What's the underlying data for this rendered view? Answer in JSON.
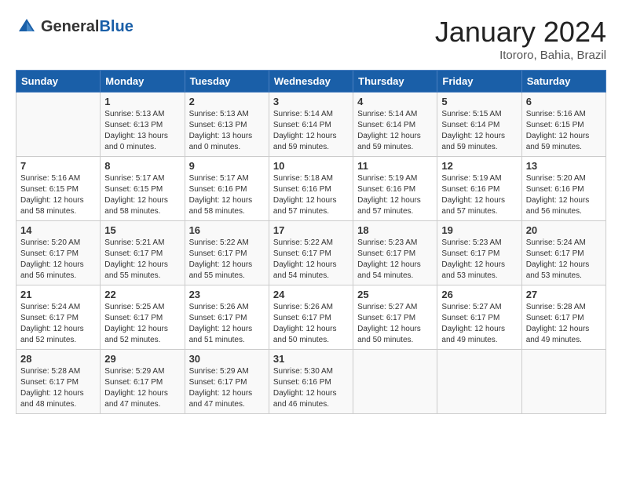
{
  "header": {
    "logo_general": "General",
    "logo_blue": "Blue",
    "title": "January 2024",
    "location": "Itororo, Bahia, Brazil"
  },
  "days_of_week": [
    "Sunday",
    "Monday",
    "Tuesday",
    "Wednesday",
    "Thursday",
    "Friday",
    "Saturday"
  ],
  "weeks": [
    [
      {
        "day": "",
        "detail": ""
      },
      {
        "day": "1",
        "detail": "Sunrise: 5:13 AM\nSunset: 6:13 PM\nDaylight: 13 hours\nand 0 minutes."
      },
      {
        "day": "2",
        "detail": "Sunrise: 5:13 AM\nSunset: 6:13 PM\nDaylight: 13 hours\nand 0 minutes."
      },
      {
        "day": "3",
        "detail": "Sunrise: 5:14 AM\nSunset: 6:14 PM\nDaylight: 12 hours\nand 59 minutes."
      },
      {
        "day": "4",
        "detail": "Sunrise: 5:14 AM\nSunset: 6:14 PM\nDaylight: 12 hours\nand 59 minutes."
      },
      {
        "day": "5",
        "detail": "Sunrise: 5:15 AM\nSunset: 6:14 PM\nDaylight: 12 hours\nand 59 minutes."
      },
      {
        "day": "6",
        "detail": "Sunrise: 5:16 AM\nSunset: 6:15 PM\nDaylight: 12 hours\nand 59 minutes."
      }
    ],
    [
      {
        "day": "7",
        "detail": "Sunrise: 5:16 AM\nSunset: 6:15 PM\nDaylight: 12 hours\nand 58 minutes."
      },
      {
        "day": "8",
        "detail": "Sunrise: 5:17 AM\nSunset: 6:15 PM\nDaylight: 12 hours\nand 58 minutes."
      },
      {
        "day": "9",
        "detail": "Sunrise: 5:17 AM\nSunset: 6:16 PM\nDaylight: 12 hours\nand 58 minutes."
      },
      {
        "day": "10",
        "detail": "Sunrise: 5:18 AM\nSunset: 6:16 PM\nDaylight: 12 hours\nand 57 minutes."
      },
      {
        "day": "11",
        "detail": "Sunrise: 5:19 AM\nSunset: 6:16 PM\nDaylight: 12 hours\nand 57 minutes."
      },
      {
        "day": "12",
        "detail": "Sunrise: 5:19 AM\nSunset: 6:16 PM\nDaylight: 12 hours\nand 57 minutes."
      },
      {
        "day": "13",
        "detail": "Sunrise: 5:20 AM\nSunset: 6:16 PM\nDaylight: 12 hours\nand 56 minutes."
      }
    ],
    [
      {
        "day": "14",
        "detail": "Sunrise: 5:20 AM\nSunset: 6:17 PM\nDaylight: 12 hours\nand 56 minutes."
      },
      {
        "day": "15",
        "detail": "Sunrise: 5:21 AM\nSunset: 6:17 PM\nDaylight: 12 hours\nand 55 minutes."
      },
      {
        "day": "16",
        "detail": "Sunrise: 5:22 AM\nSunset: 6:17 PM\nDaylight: 12 hours\nand 55 minutes."
      },
      {
        "day": "17",
        "detail": "Sunrise: 5:22 AM\nSunset: 6:17 PM\nDaylight: 12 hours\nand 54 minutes."
      },
      {
        "day": "18",
        "detail": "Sunrise: 5:23 AM\nSunset: 6:17 PM\nDaylight: 12 hours\nand 54 minutes."
      },
      {
        "day": "19",
        "detail": "Sunrise: 5:23 AM\nSunset: 6:17 PM\nDaylight: 12 hours\nand 53 minutes."
      },
      {
        "day": "20",
        "detail": "Sunrise: 5:24 AM\nSunset: 6:17 PM\nDaylight: 12 hours\nand 53 minutes."
      }
    ],
    [
      {
        "day": "21",
        "detail": "Sunrise: 5:24 AM\nSunset: 6:17 PM\nDaylight: 12 hours\nand 52 minutes."
      },
      {
        "day": "22",
        "detail": "Sunrise: 5:25 AM\nSunset: 6:17 PM\nDaylight: 12 hours\nand 52 minutes."
      },
      {
        "day": "23",
        "detail": "Sunrise: 5:26 AM\nSunset: 6:17 PM\nDaylight: 12 hours\nand 51 minutes."
      },
      {
        "day": "24",
        "detail": "Sunrise: 5:26 AM\nSunset: 6:17 PM\nDaylight: 12 hours\nand 50 minutes."
      },
      {
        "day": "25",
        "detail": "Sunrise: 5:27 AM\nSunset: 6:17 PM\nDaylight: 12 hours\nand 50 minutes."
      },
      {
        "day": "26",
        "detail": "Sunrise: 5:27 AM\nSunset: 6:17 PM\nDaylight: 12 hours\nand 49 minutes."
      },
      {
        "day": "27",
        "detail": "Sunrise: 5:28 AM\nSunset: 6:17 PM\nDaylight: 12 hours\nand 49 minutes."
      }
    ],
    [
      {
        "day": "28",
        "detail": "Sunrise: 5:28 AM\nSunset: 6:17 PM\nDaylight: 12 hours\nand 48 minutes."
      },
      {
        "day": "29",
        "detail": "Sunrise: 5:29 AM\nSunset: 6:17 PM\nDaylight: 12 hours\nand 47 minutes."
      },
      {
        "day": "30",
        "detail": "Sunrise: 5:29 AM\nSunset: 6:17 PM\nDaylight: 12 hours\nand 47 minutes."
      },
      {
        "day": "31",
        "detail": "Sunrise: 5:30 AM\nSunset: 6:16 PM\nDaylight: 12 hours\nand 46 minutes."
      },
      {
        "day": "",
        "detail": ""
      },
      {
        "day": "",
        "detail": ""
      },
      {
        "day": "",
        "detail": ""
      }
    ]
  ]
}
